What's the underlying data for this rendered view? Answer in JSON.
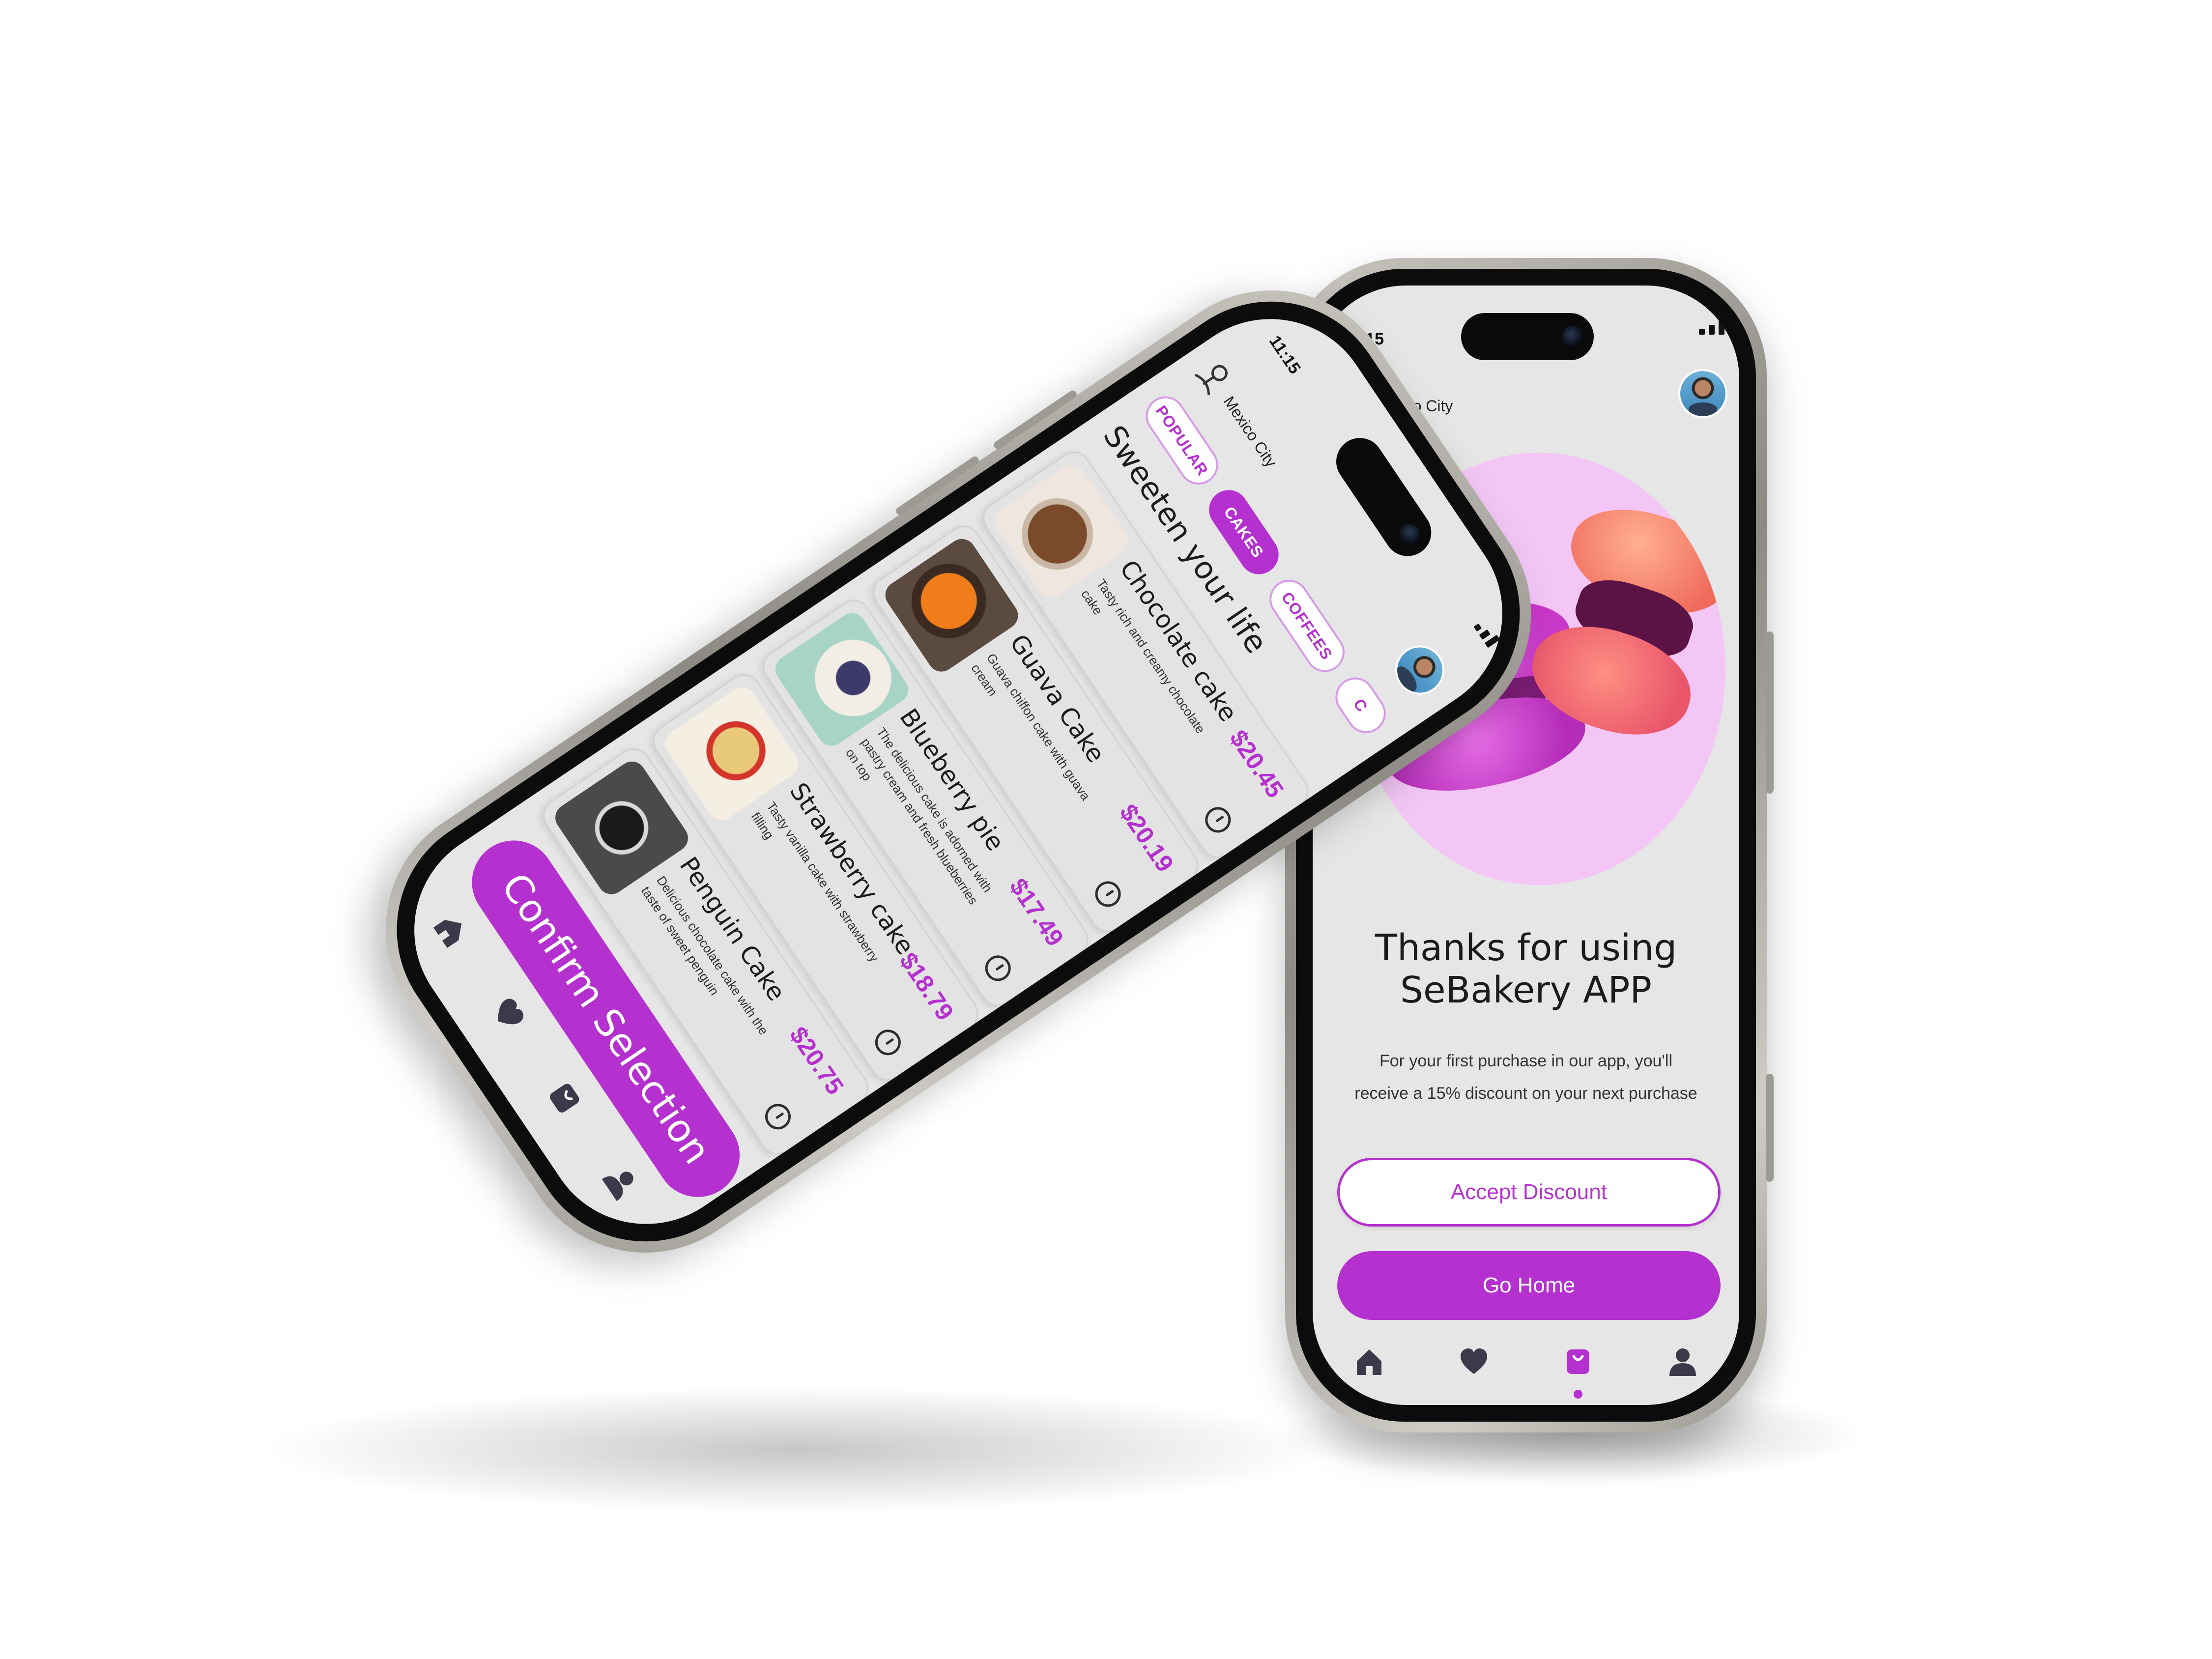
{
  "left_phone": {
    "status_time": "11:15",
    "location": "Mexico City",
    "title": "Sweeten your life",
    "categories": [
      {
        "label": "POPULAR",
        "selected": false
      },
      {
        "label": "CAKES",
        "selected": true
      },
      {
        "label": "COFFEES",
        "selected": false
      },
      {
        "label": "C",
        "selected": false
      }
    ],
    "products": [
      {
        "name": "Chocolate cake",
        "description": "Tasty rich and creamy chocolate cake",
        "price": "$20.45",
        "thumb_icon": "chocolate-cake-image"
      },
      {
        "name": "Guava Cake",
        "description": "Guava chiffon cake with guava cream",
        "price": "$20.19",
        "thumb_icon": "guava-cake-image"
      },
      {
        "name": "Blueberry pie",
        "description": "The delicious cake is adorned with pastry cream and fresh blueberries on top",
        "price": "$17.49",
        "thumb_icon": "blueberry-pie-image"
      },
      {
        "name": "Strawberry cake",
        "description": "Tasty vanilla cake with strawberry filling",
        "price": "$18.79",
        "thumb_icon": "strawberry-cake-image"
      },
      {
        "name": "Penguin Cake",
        "description": "Delicious chocolate cake with the taste of sweet penguin",
        "price": "$20.75",
        "thumb_icon": "penguin-cake-image"
      }
    ],
    "confirm_label": "Confirm Selection",
    "nav": [
      "home-icon",
      "heart-icon",
      "bag-icon",
      "user-icon"
    ]
  },
  "right_phone": {
    "status_time": "11:15",
    "location": "Mexico City",
    "headline_line1": "Thanks for using",
    "headline_line2": "SeBakery APP",
    "body_line1": "For your first purchase in our app, you'll",
    "body_line2": "receive a 15% discount on your next purchase",
    "accept_label": "Accept Discount",
    "home_label": "Go Home",
    "nav": [
      "home-icon",
      "heart-icon",
      "bag-icon",
      "user-icon"
    ],
    "active_nav": "bag-icon"
  },
  "colors": {
    "accent": "#b531cf",
    "screen_bg": "#e6e6e6",
    "macaron_bg": "#f3c6f6"
  }
}
